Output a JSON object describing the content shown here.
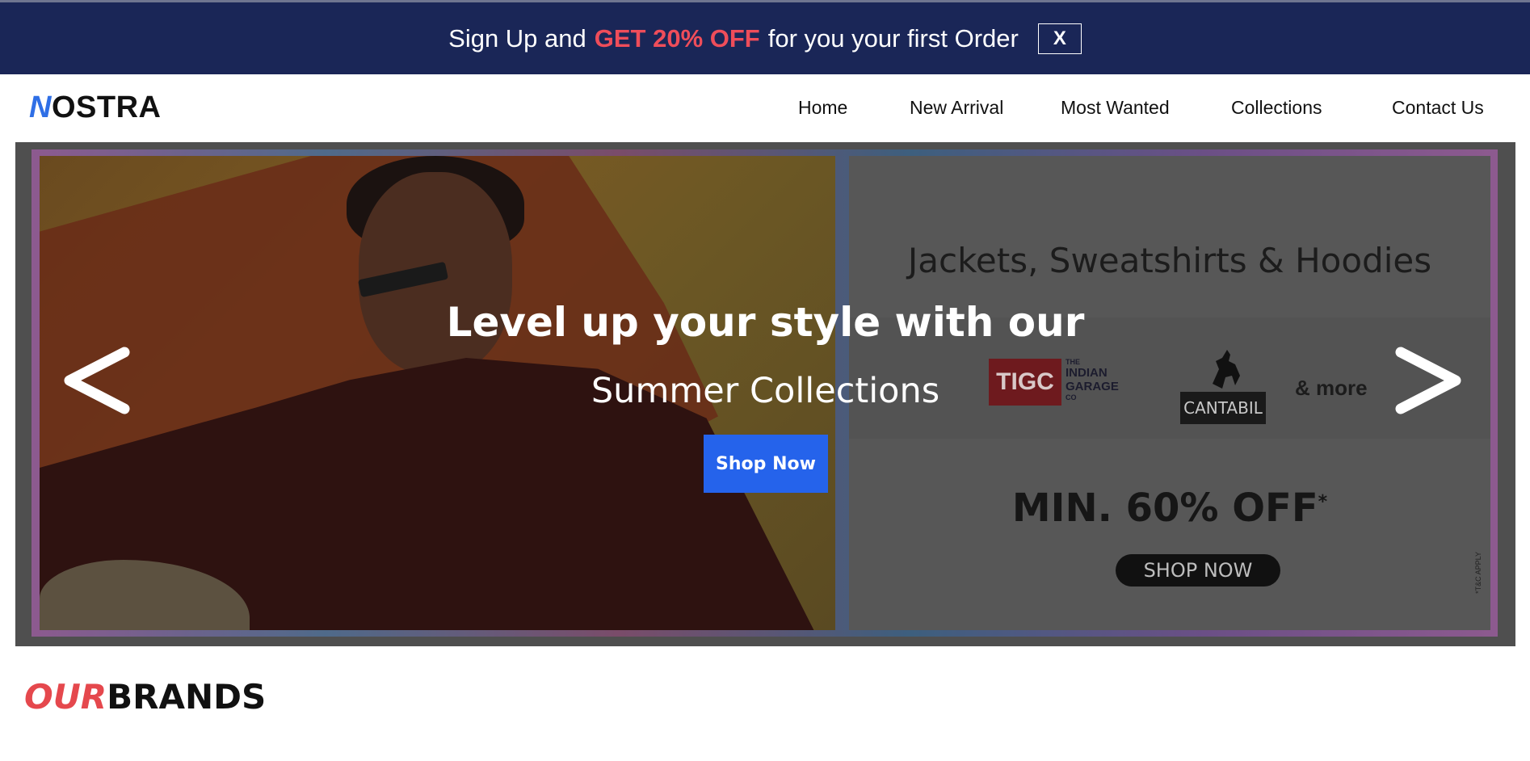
{
  "promo": {
    "text_before": "Sign Up and",
    "highlight": "GET 20% OFF",
    "text_after": "for you your first Order",
    "close_label": "X"
  },
  "logo": {
    "first_letter": "N",
    "rest": "OSTRA"
  },
  "nav": {
    "items": [
      {
        "label": "Home"
      },
      {
        "label": "New Arrival"
      },
      {
        "label": "Most Wanted"
      },
      {
        "label": "Collections"
      },
      {
        "label": "Contact Us"
      }
    ]
  },
  "hero": {
    "title": "Level up your style with our",
    "subtitle": "Summer Collections",
    "cta_label": "Shop Now",
    "banner": {
      "heading": "Jackets, Sweatshirts & Hoodies",
      "brand_1": "TIGC",
      "brand_2_line1": "THE",
      "brand_2_line2": "INDIAN",
      "brand_2_line3": "GARAGE",
      "brand_2_line4": "CO",
      "brand_3": "CANTABIL",
      "more": "& more",
      "offer": "MIN. 60% OFF",
      "offer_mark": "*",
      "shop_label": "SHOP NOW",
      "tc": "*T&C APPLY"
    }
  },
  "brands_section": {
    "accent": "OUR",
    "rest": "BRANDS"
  },
  "colors": {
    "promo_bg": "#1a2657",
    "promo_highlight": "#ef4d5a",
    "logo_accent": "#2f6fe6",
    "cta_bg": "#2563eb",
    "heading_accent": "#e5484d"
  }
}
